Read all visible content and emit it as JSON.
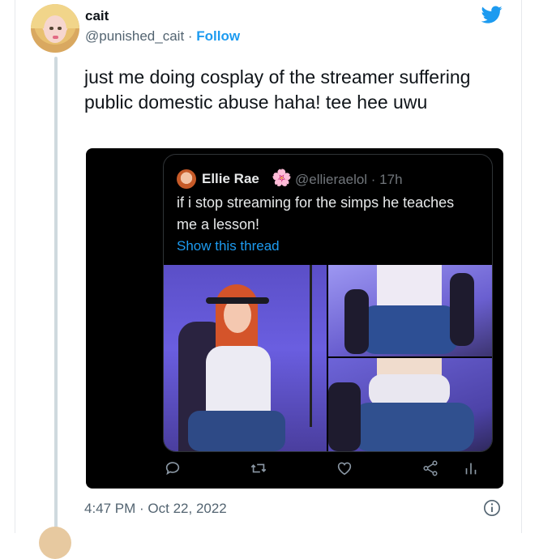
{
  "author": {
    "display_name": "cait",
    "handle": "@punished_cait",
    "separator": " · ",
    "follow_label": "Follow"
  },
  "tweet": {
    "text": "just me doing cosplay of the streamer suffering public domestic abuse haha! tee hee uwu",
    "timestamp": "4:47 PM · Oct 22, 2022"
  },
  "quoted_tweet": {
    "display_name": "Ellie Rae",
    "badge_emoji": "🌸",
    "meta": "@ellieraelol · 17h",
    "text": "if i stop streaming for the simps he teaches me a lesson!",
    "thread_link": "Show this thread"
  },
  "icons": {
    "brand": "twitter-bird-icon",
    "actions": [
      "reply-icon",
      "retweet-icon",
      "like-icon",
      "share-icon",
      "analytics-icon"
    ],
    "info": "info-icon"
  },
  "colors": {
    "accent": "#1d9bf0",
    "text_primary": "#0f1419",
    "text_secondary": "#536471",
    "media_bg": "#000000"
  }
}
